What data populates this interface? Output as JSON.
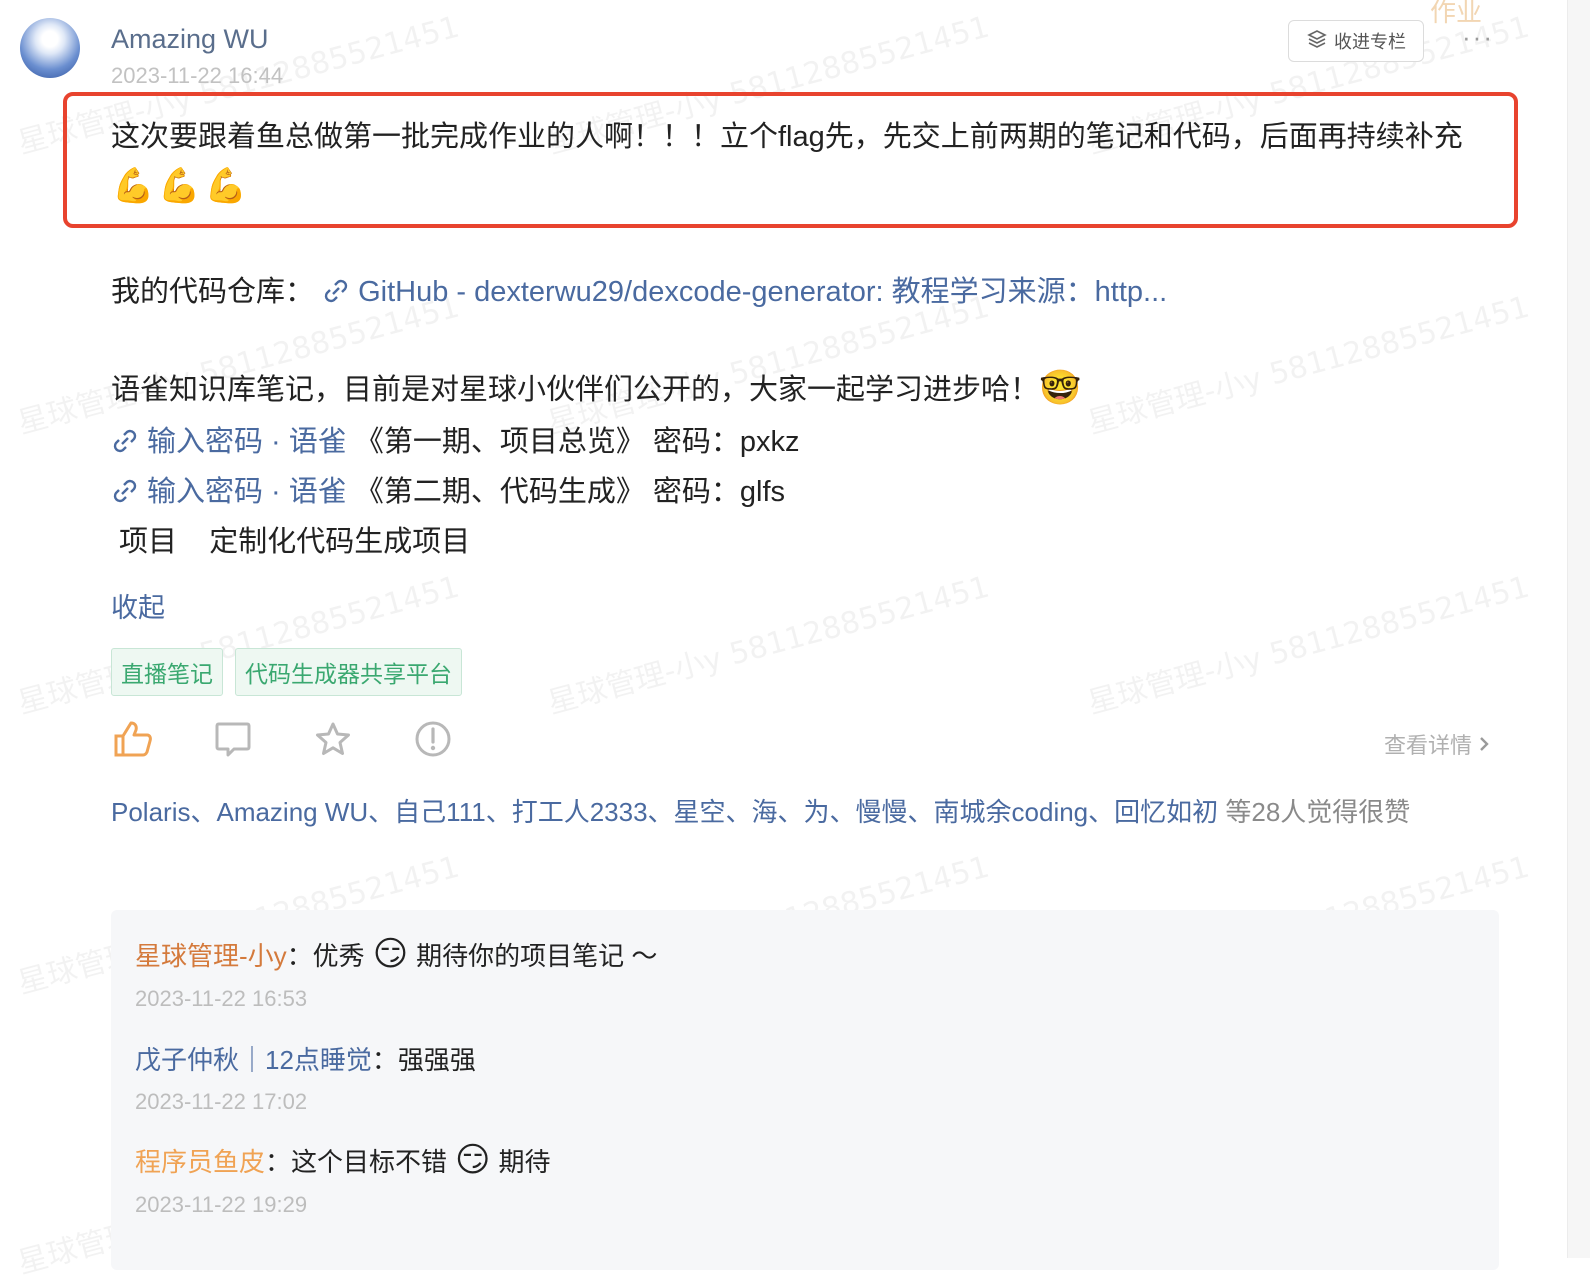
{
  "post": {
    "author": "Amazing WU",
    "time": "2023-11-22 16:44",
    "collect_label": "收进专栏",
    "more_label": "···",
    "corner_label": "作业",
    "text": "这次要跟着鱼总做第一批完成作业的人啊！！！立个flag先，先交上前两期的笔记和代码，后面再持续补充",
    "emojis": "💪💪💪"
  },
  "body": {
    "repo_label": "我的代码仓库：",
    "repo_link": "GitHub - dexterwu29/dexcode-generator: 教程学习来源：http...",
    "note_intro": "语雀知识库笔记，目前是对星球小伙伴们公开的，大家一起学习进步哈！",
    "note_emoji": "🤓",
    "notes": [
      {
        "link": "输入密码 · 语雀",
        "rest": " 《第一期、项目总览》 密码：pxkz"
      },
      {
        "link": "输入密码 · 语雀",
        "rest": " 《第二期、代码生成》 密码：glfs"
      }
    ],
    "project_line": " 项目    定制化代码生成项目",
    "collapse": "收起"
  },
  "tags": [
    "直播笔记",
    "代码生成器共享平台"
  ],
  "actions": {
    "detail_label": "查看详情",
    "colors": {
      "like": "#f0a354",
      "inactive": "#b8b8b8"
    }
  },
  "likes": {
    "names": "Polaris、Amazing WU、自己111、打工人2333、星空、海、为、慢慢、南城余coding、回忆如初",
    "tail": " 等28人觉得很赞"
  },
  "comments": [
    {
      "user": "星球管理-小y",
      "user_color": "#d47a3c",
      "text_a": "：优秀 ",
      "emoji": "😏",
      "text_b": " 期待你的项目笔记 ～",
      "time": "2023-11-22 16:53"
    },
    {
      "user": "戊子仲秋｜12点睡觉",
      "user_color": "#4a6aa0",
      "text_a": "：强强强",
      "emoji": "",
      "text_b": "",
      "time": "2023-11-22 17:02"
    },
    {
      "user": "程序员鱼皮",
      "user_color": "#f0a354",
      "text_a": "：这个目标不错 ",
      "emoji": "😏",
      "text_b": " 期待",
      "time": "2023-11-22 19:29"
    }
  ],
  "watermark": "星球管理-小y 58112885521451"
}
